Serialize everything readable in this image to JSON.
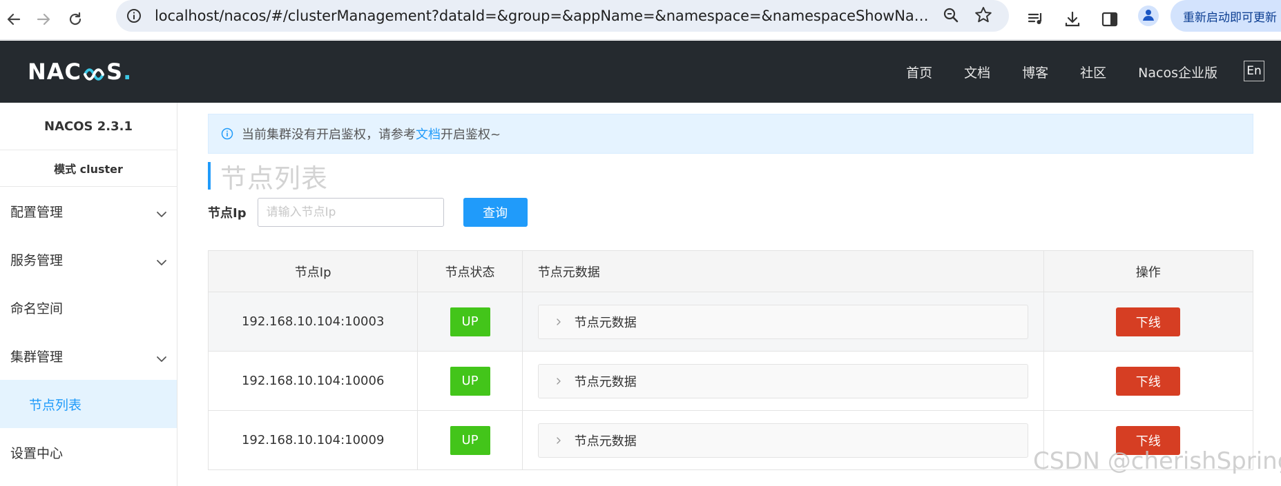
{
  "browser": {
    "url": "localhost/nacos/#/clusterManagement?dataId=&group=&appName=&namespace=&namespaceShowName...",
    "update_label": "重新启动即可更新"
  },
  "topnav": {
    "logo_text_a": "NAC",
    "logo_text_b": "S",
    "logo_dot": ".",
    "links": [
      "首页",
      "文档",
      "博客",
      "社区",
      "Nacos企业版"
    ],
    "lang": "En"
  },
  "sidebar": {
    "version": "NACOS 2.3.1",
    "mode": "模式 cluster",
    "items": [
      {
        "label": "配置管理"
      },
      {
        "label": "服务管理"
      },
      {
        "label": "命名空间"
      },
      {
        "label": "集群管理"
      },
      {
        "label": "节点列表"
      },
      {
        "label": "设置中心"
      }
    ]
  },
  "notice": {
    "text_before": "当前集群没有开启鉴权，请参考",
    "link": "文档",
    "text_after": "开启鉴权~"
  },
  "page": {
    "title": "节点列表"
  },
  "search": {
    "label": "节点Ip",
    "placeholder": "请输入节点Ip",
    "query_label": "查询"
  },
  "table": {
    "headers": [
      "节点Ip",
      "节点状态",
      "节点元数据",
      "操作"
    ],
    "rows": [
      {
        "ip": "192.168.10.104:10003",
        "status": "UP",
        "meta": "节点元数据",
        "action": "下线"
      },
      {
        "ip": "192.168.10.104:10006",
        "status": "UP",
        "meta": "节点元数据",
        "action": "下线"
      },
      {
        "ip": "192.168.10.104:10009",
        "status": "UP",
        "meta": "节点元数据",
        "action": "下线"
      }
    ]
  },
  "watermark": "CSDN @cherishSpring",
  "colors": {
    "brand_blue": "#209bfa",
    "nav_bg": "#252a2f",
    "status_up": "#43c51a",
    "danger": "#d63e23"
  }
}
